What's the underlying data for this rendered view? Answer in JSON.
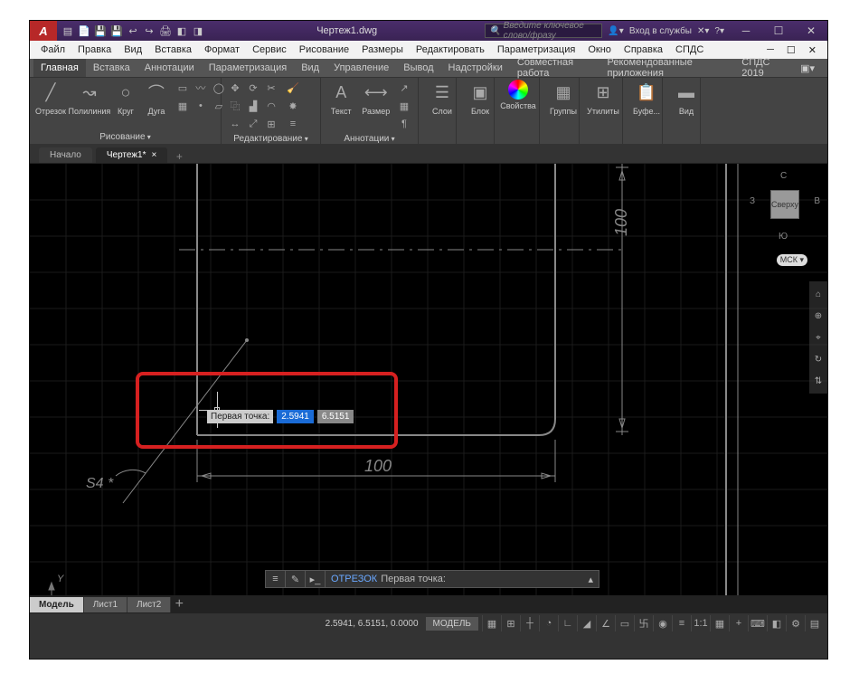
{
  "titlebar": {
    "title": "Чертеж1.dwg",
    "search_placeholder": "Введите ключевое слово/фразу",
    "signin": "Вход в службы",
    "qat": [
      "▤",
      "📄",
      "💾",
      "💾",
      "↩",
      "↪",
      "🖨",
      "◧",
      "◨"
    ]
  },
  "win": {
    "min": "─",
    "max": "☐",
    "close": "✕"
  },
  "menubar": [
    "Файл",
    "Правка",
    "Вид",
    "Вставка",
    "Формат",
    "Сервис",
    "Рисование",
    "Размеры",
    "Редактировать",
    "Параметризация",
    "Окно",
    "Справка",
    "СПДС"
  ],
  "ribbon_tabs": [
    "Главная",
    "Вставка",
    "Аннотации",
    "Параметризация",
    "Вид",
    "Управление",
    "Вывод",
    "Надстройки",
    "Совместная работа",
    "Рекомендованные приложения",
    "СПДС 2019"
  ],
  "ribbon_active": 0,
  "panels": {
    "draw": {
      "title": "Рисование",
      "line": "Отрезок",
      "pline": "Полилиния",
      "circle": "Круг",
      "arc": "Дуга"
    },
    "modify": {
      "title": "Редактирование"
    },
    "annot": {
      "title": "Аннотации",
      "text": "Текст",
      "dim": "Размер"
    },
    "layers": {
      "label": "Слои"
    },
    "block": {
      "label": "Блок"
    },
    "props": {
      "label": "Свойства"
    },
    "groups": {
      "label": "Группы"
    },
    "util": {
      "label": "Утилиты"
    },
    "clip": {
      "label": "Буфе..."
    },
    "view": {
      "label": "Вид"
    }
  },
  "doctabs": {
    "start": "Начало",
    "d1": "Чертеж1*"
  },
  "viewcube": {
    "top": "Сверху",
    "n": "С",
    "s": "Ю",
    "e": "В",
    "w": "З",
    "wcs": "МСК"
  },
  "dims": {
    "d100v": "100",
    "d100h": "100",
    "s4": "S4 *"
  },
  "dyninput": {
    "label": "Первая точка:",
    "x": "2.5941",
    "y": "6.5151"
  },
  "cmdline": {
    "cmd": "ОТРЕЗОК",
    "prompt": "Первая точка:"
  },
  "mtabs": {
    "model": "Модель",
    "l1": "Лист1",
    "l2": "Лист2"
  },
  "status": {
    "coords": "2.5941, 6.5151, 0.0000",
    "model": "МОДЕЛЬ",
    "ratio": "1:1",
    "icons": [
      "▦",
      "⊞",
      "┼",
      "◔",
      "∟",
      "◢",
      "∠",
      "▭",
      "卐",
      "◉",
      "≡",
      "⊕",
      "▦",
      "+",
      "⌨",
      "◧",
      "⚙",
      "▤"
    ]
  },
  "navbar": [
    "⌂",
    "⊕",
    "⌖",
    "↻",
    "⇅"
  ]
}
